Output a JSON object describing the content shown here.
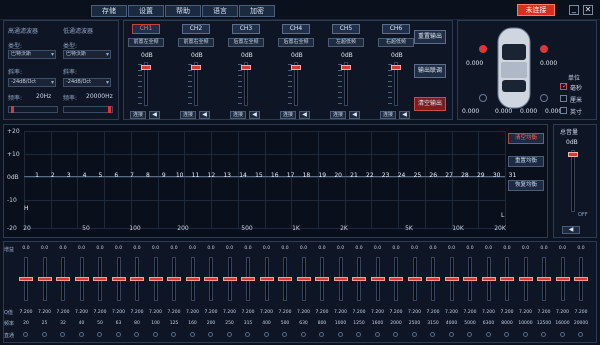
{
  "menu": {
    "store": "存储",
    "settings": "设置",
    "help": "帮助",
    "language": "语言",
    "encrypt": "加密"
  },
  "status": {
    "connection": "未连接"
  },
  "filters": {
    "hpf_title": "高通滤波器",
    "lpf_title": "低通滤波器",
    "type_label": "类型:",
    "hpf_type": "巴特沃斯",
    "lpf_type": "巴特沃斯",
    "slope_label": "斜率:",
    "hpf_slope": "-24dB/Oct",
    "lpf_slope": "-24dB/Oct",
    "freq_label": "频率:",
    "hpf_freq": "20Hz",
    "lpf_freq": "20000Hz"
  },
  "channels": [
    {
      "name": "CH1",
      "position": "前置左全频",
      "level": "0dB",
      "delay": "0.000"
    },
    {
      "name": "CH2",
      "position": "前置右全频",
      "level": "0dB",
      "delay": "0.000"
    },
    {
      "name": "CH3",
      "position": "后置左全频",
      "level": "0dB",
      "delay": "0.000"
    },
    {
      "name": "CH4",
      "position": "后置右全频",
      "level": "0dB",
      "delay": "0.000"
    },
    {
      "name": "CH5",
      "position": "左超低频",
      "level": "0dB",
      "delay": "0.000"
    },
    {
      "name": "CH6",
      "position": "右超低频",
      "level": "0dB",
      "delay": "0.000"
    }
  ],
  "channel_btn": {
    "link": "连接"
  },
  "side_buttons": {
    "reset_output": "重置输出",
    "output_link": "输出联调",
    "clear_output": "清空输出"
  },
  "car": {
    "delay_fl": "0.000",
    "delay_fr": "0.000",
    "delay_rl": "0.000",
    "delay_rr": "0.000",
    "delay_sub_l": "0.000",
    "delay_sub_r": "0.000"
  },
  "units": {
    "title": "单位",
    "ms": "毫秒",
    "cm": "厘米",
    "inch": "英寸"
  },
  "graph": {
    "y_labels": [
      "+20",
      "+10",
      "0dB",
      "-10",
      "-20"
    ],
    "x_labels": [
      "20",
      "50",
      "100",
      "200",
      "500",
      "1K",
      "2K",
      "5K",
      "10K",
      "20K"
    ],
    "eq_points": [
      "1",
      "2",
      "3",
      "4",
      "5",
      "6",
      "7",
      "8",
      "9",
      "10",
      "11",
      "12",
      "13",
      "14",
      "15",
      "16",
      "17",
      "18",
      "19",
      "20",
      "21",
      "22",
      "23",
      "24",
      "25",
      "26",
      "27",
      "28",
      "29",
      "30",
      "31"
    ],
    "corner_l": "L",
    "corner_h": "H"
  },
  "eq_buttons": {
    "clear_eq": "清空均衡",
    "reset_eq": "重置均衡",
    "restore_eq": "恢复均衡"
  },
  "master": {
    "title": "总音量",
    "level": "0dB",
    "off_label": "OFF"
  },
  "band_labels": {
    "gain": "增益",
    "q": "Q值",
    "freq": "频率",
    "pass": "直通"
  },
  "bands": [
    {
      "gain": "0.0",
      "q": "7.200",
      "freq": "20"
    },
    {
      "gain": "0.0",
      "q": "7.200",
      "freq": "25"
    },
    {
      "gain": "0.0",
      "q": "7.200",
      "freq": "32"
    },
    {
      "gain": "0.0",
      "q": "7.200",
      "freq": "40"
    },
    {
      "gain": "0.0",
      "q": "7.200",
      "freq": "50"
    },
    {
      "gain": "0.0",
      "q": "7.200",
      "freq": "63"
    },
    {
      "gain": "0.0",
      "q": "7.200",
      "freq": "80"
    },
    {
      "gain": "0.0",
      "q": "7.200",
      "freq": "100"
    },
    {
      "gain": "0.0",
      "q": "7.200",
      "freq": "125"
    },
    {
      "gain": "0.0",
      "q": "7.200",
      "freq": "160"
    },
    {
      "gain": "0.0",
      "q": "7.200",
      "freq": "200"
    },
    {
      "gain": "0.0",
      "q": "7.200",
      "freq": "250"
    },
    {
      "gain": "0.0",
      "q": "7.200",
      "freq": "315"
    },
    {
      "gain": "0.0",
      "q": "7.200",
      "freq": "400"
    },
    {
      "gain": "0.0",
      "q": "7.200",
      "freq": "500"
    },
    {
      "gain": "0.0",
      "q": "7.200",
      "freq": "630"
    },
    {
      "gain": "0.0",
      "q": "7.200",
      "freq": "800"
    },
    {
      "gain": "0.0",
      "q": "7.200",
      "freq": "1000"
    },
    {
      "gain": "0.0",
      "q": "7.200",
      "freq": "1250"
    },
    {
      "gain": "0.0",
      "q": "7.200",
      "freq": "1600"
    },
    {
      "gain": "0.0",
      "q": "7.200",
      "freq": "2000"
    },
    {
      "gain": "0.0",
      "q": "7.200",
      "freq": "2500"
    },
    {
      "gain": "0.0",
      "q": "7.200",
      "freq": "3150"
    },
    {
      "gain": "0.0",
      "q": "7.200",
      "freq": "4000"
    },
    {
      "gain": "0.0",
      "q": "7.200",
      "freq": "5000"
    },
    {
      "gain": "0.0",
      "q": "7.200",
      "freq": "6300"
    },
    {
      "gain": "0.0",
      "q": "7.200",
      "freq": "8000"
    },
    {
      "gain": "0.0",
      "q": "7.200",
      "freq": "10000"
    },
    {
      "gain": "0.0",
      "q": "7.200",
      "freq": "12500"
    },
    {
      "gain": "0.0",
      "q": "7.200",
      "freq": "16000"
    },
    {
      "gain": "0.0",
      "q": "7.200",
      "freq": "20000"
    }
  ],
  "colors": {
    "accent_red": "#d83838",
    "bg": "#0b1220",
    "panel_border": "#2d3b52"
  }
}
